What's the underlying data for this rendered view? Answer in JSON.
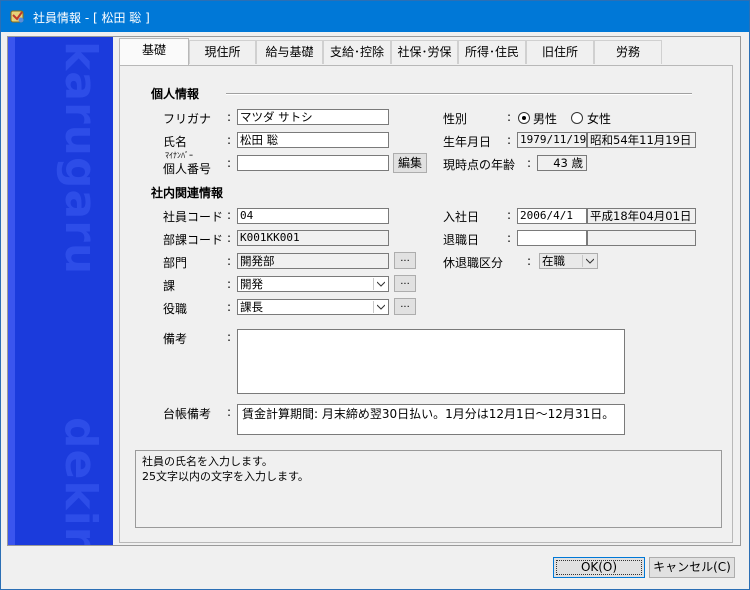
{
  "window": {
    "title": "社員情報 - [ 松田 聡 ]"
  },
  "banner": {
    "top_text": "karugaru",
    "bottom_text": "dekiru"
  },
  "tabs": [
    "基礎",
    "現住所",
    "給与基礎",
    "支給･控除",
    "社保･労保",
    "所得･住民",
    "旧住所",
    "労務"
  ],
  "personal": {
    "section_title": "個人情報",
    "furigana_label": "フリガナ",
    "furigana_value": "マツダ サトシ",
    "name_label": "氏名",
    "name_value": "松田 聡",
    "mynumber_small": "ﾏｲﾅﾝﾊﾞｰ",
    "mynumber_label": "個人番号",
    "mynumber_value": "",
    "edit_button": "編集",
    "gender_label": "性別",
    "gender_options": [
      "男性",
      "女性"
    ],
    "gender_selected": "男性",
    "birth_label": "生年月日",
    "birth_date": "1979/11/19",
    "birth_wareki": "昭和54年11月19日",
    "age_label": "現時点の年齢",
    "age_value": "43 歳"
  },
  "company": {
    "section_title": "社内関連情報",
    "code_label": "社員コード",
    "code_value": "04",
    "dept_code_label": "部課コード",
    "dept_code_value": "K001KK001",
    "dept_label": "部門",
    "dept_value": "開発部",
    "section_label": "課",
    "section_value": "開発",
    "position_label": "役職",
    "position_value": "課長",
    "join_label": "入社日",
    "join_date": "2006/4/1",
    "join_wareki": "平成18年04月01日",
    "retire_label": "退職日",
    "retire_date": "",
    "retire_wareki": "",
    "status_label": "休退職区分",
    "status_value": "在職",
    "dots": "..."
  },
  "notes": {
    "label": "備考",
    "value": ""
  },
  "ledger": {
    "label": "台帳備考",
    "value": "賃金計算期間: 月末締め翌30日払い。1月分は12月1日～12月31日。"
  },
  "help": {
    "line1": "社員の氏名を入力します。",
    "line2": "25文字以内の文字を入力します。"
  },
  "buttons": {
    "ok": "OK(O)",
    "cancel": "キャンセル(C)"
  }
}
